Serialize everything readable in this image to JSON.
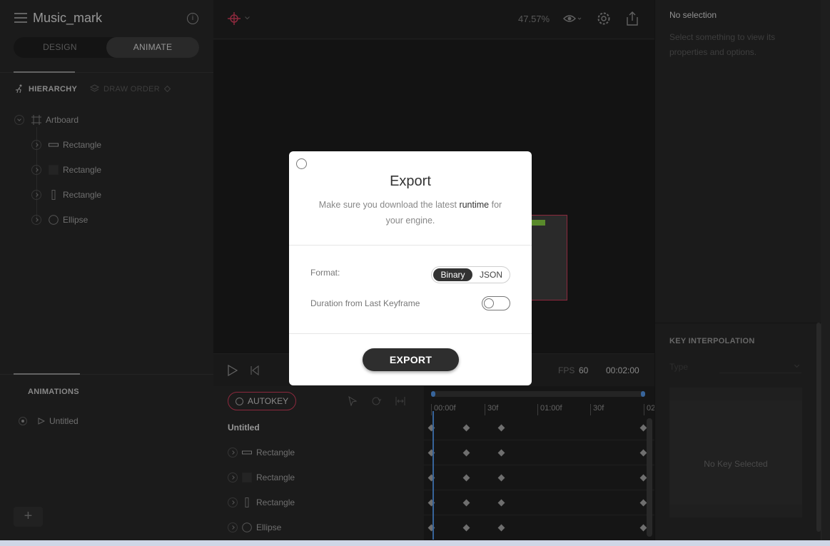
{
  "left": {
    "project_title": "Music_mark",
    "modes": {
      "design": "DESIGN",
      "animate": "ANIMATE"
    },
    "tabs": {
      "hierarchy": "HIERARCHY",
      "draw_order": "DRAW ORDER"
    },
    "tree": [
      {
        "label": "Artboard",
        "icon": "artboard-icon"
      },
      {
        "label": "Rectangle",
        "icon": "rectangle-horizontal-icon"
      },
      {
        "label": "Rectangle",
        "icon": "rectangle-square-icon"
      },
      {
        "label": "Rectangle",
        "icon": "rectangle-vertical-icon"
      },
      {
        "label": "Ellipse",
        "icon": "ellipse-icon"
      }
    ],
    "animations_header": "ANIMATIONS",
    "animations": [
      {
        "label": "Untitled"
      }
    ]
  },
  "center": {
    "zoom": "47.57%",
    "fps_label": "FPS",
    "fps_value": "60",
    "duration": "00:02:00",
    "autokey": "AUTOKEY",
    "timeline": {
      "ticks": [
        "00:00f",
        "30f",
        "01:00f",
        "30f",
        "02"
      ],
      "rows": [
        {
          "label": "Untitled",
          "bold": true
        },
        {
          "label": "Rectangle"
        },
        {
          "label": "Rectangle"
        },
        {
          "label": "Rectangle"
        },
        {
          "label": "Ellipse"
        }
      ]
    }
  },
  "right": {
    "no_selection": "No selection",
    "hint": "Select something to view its properties and options.",
    "key_interpolation": "KEY INTERPOLATION",
    "type_label": "Type",
    "no_key": "No Key Selected"
  },
  "modal": {
    "title": "Export",
    "desc_before": "Make sure you download the latest",
    "desc_link": "runtime",
    "desc_after": "for your engine.",
    "format_label": "Format:",
    "format_options": [
      "Binary",
      "JSON"
    ],
    "format_selected": "Binary",
    "duration_label": "Duration from Last Keyframe",
    "duration_toggle_on": false,
    "export_button": "EXPORT"
  },
  "colors": {
    "accent_red": "#c23a55",
    "accent_blue": "#4d8bd6",
    "green": "#7cbf3c"
  }
}
